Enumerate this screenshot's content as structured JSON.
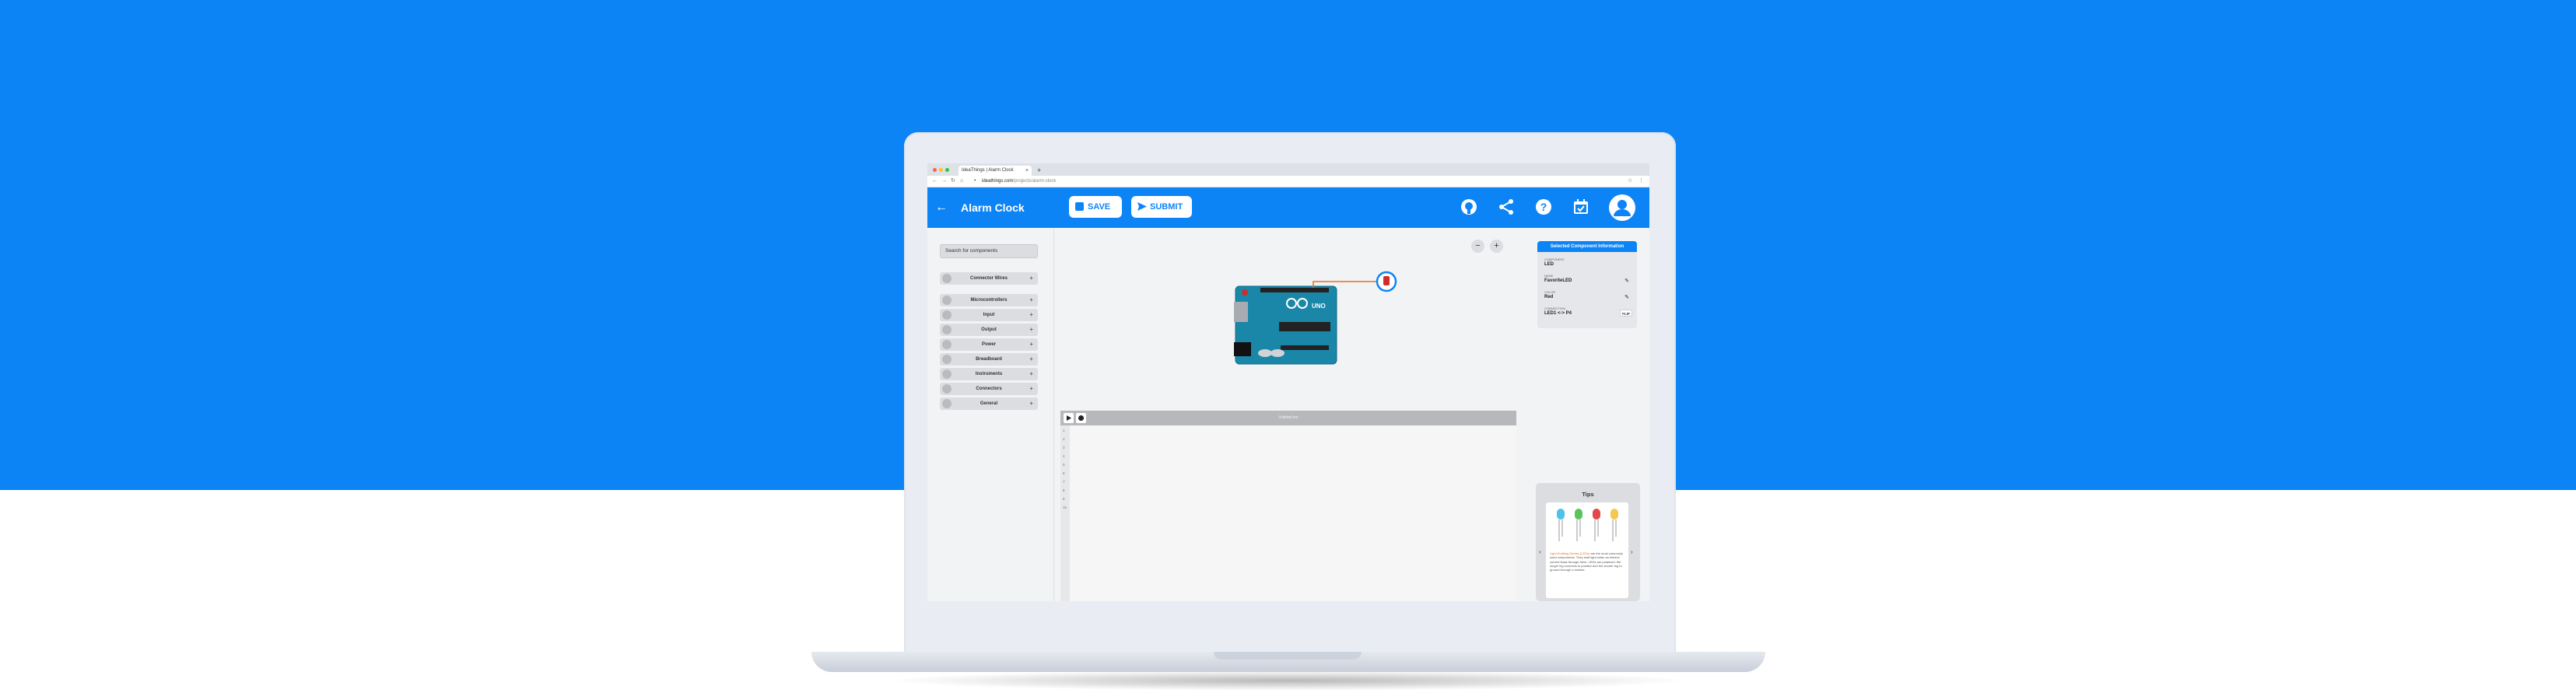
{
  "colors": {
    "brand_blue": "#0d84f5",
    "page_bg_bottom": "#ffffff",
    "laptop_frame": "#e9edf3",
    "panel_bg": "#f2f3f5",
    "item_bg": "#dcdde0"
  },
  "browser": {
    "tab_title": "IdeaThings | Alarm Clock",
    "tab_close": "×",
    "new_tab": "+",
    "url_domain": "ideathings.com",
    "url_path": "/projects/alarm-clock"
  },
  "header": {
    "back_icon": "arrow-left-icon",
    "title": "Alarm Clock",
    "save_label": "SAVE",
    "submit_label": "SUBMIT",
    "icons": [
      "github-icon",
      "share-icon",
      "help-icon",
      "calendar-icon",
      "user-icon"
    ]
  },
  "sidebar": {
    "search_placeholder": "Search for components",
    "wires": {
      "label": "Connector Wires",
      "toggle": "+"
    },
    "categories": [
      {
        "label": "Microcontrollers",
        "toggle": "+"
      },
      {
        "label": "Input",
        "toggle": "+"
      },
      {
        "label": "Output",
        "toggle": "+"
      },
      {
        "label": "Power",
        "toggle": "+"
      },
      {
        "label": "Breadboard",
        "toggle": "+"
      },
      {
        "label": "Instruments",
        "toggle": "+"
      },
      {
        "label": "Connectors",
        "toggle": "+"
      },
      {
        "label": "General",
        "toggle": "+"
      }
    ]
  },
  "canvas": {
    "zoom_out": "−",
    "zoom_in": "+"
  },
  "code_editor": {
    "title": "Untitled.ino",
    "line_numbers": [
      "1",
      "2",
      "3",
      "4",
      "5",
      "6",
      "7",
      "8",
      "9",
      "10"
    ]
  },
  "component_info": {
    "title": "Selected Component Information",
    "fields": [
      {
        "label": "COMPONENT",
        "value": "LED",
        "editable": false
      },
      {
        "label": "NAME",
        "value": "FavoriteLED",
        "editable": true
      },
      {
        "label": "COLOR",
        "value": "Red",
        "editable": true
      },
      {
        "label": "CONNECTION",
        "value": "LED1 <-> P4",
        "editable": false
      }
    ],
    "edit_glyph": "✎",
    "flip_label": "FLIP"
  },
  "tips": {
    "title": "Tips",
    "prev": "‹",
    "next": "›",
    "highlight": "Light Emitting Diodes (LEDs)",
    "text": " are the most commonly used components. They emit light when an electric current flows through them. LEDs are polarized: the longer leg connects to positive and the shorter leg to ground through a resistor."
  }
}
